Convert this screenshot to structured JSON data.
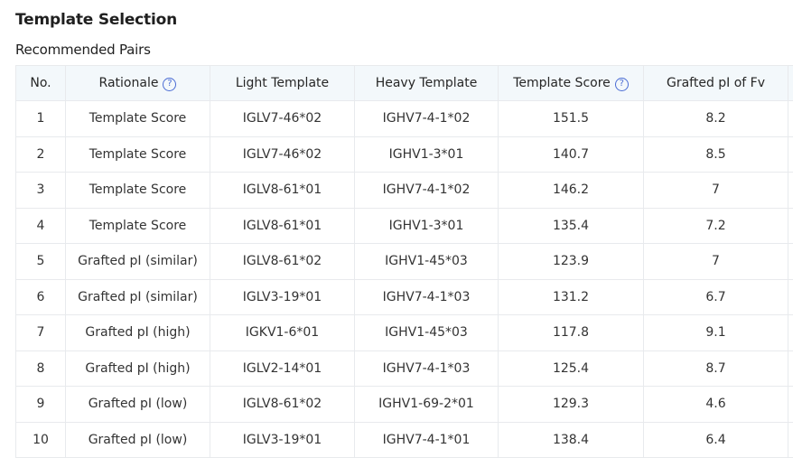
{
  "page": {
    "title": "Template Selection",
    "section_title": "Recommended Pairs"
  },
  "table": {
    "headers": {
      "no": "No.",
      "rationale": "Rationale",
      "light": "Light Template",
      "heavy": "Heavy Template",
      "score": "Template Score",
      "pi": "Grafted pI of Fv"
    },
    "rows": [
      {
        "no": "1",
        "rationale": "Template Score",
        "light": "IGLV7-46*02",
        "heavy": "IGHV7-4-1*02",
        "score": "151.5",
        "pi": "8.2"
      },
      {
        "no": "2",
        "rationale": "Template Score",
        "light": "IGLV7-46*02",
        "heavy": "IGHV1-3*01",
        "score": "140.7",
        "pi": "8.5"
      },
      {
        "no": "3",
        "rationale": "Template Score",
        "light": "IGLV8-61*01",
        "heavy": "IGHV7-4-1*02",
        "score": "146.2",
        "pi": "7"
      },
      {
        "no": "4",
        "rationale": "Template Score",
        "light": "IGLV8-61*01",
        "heavy": "IGHV1-3*01",
        "score": "135.4",
        "pi": "7.2"
      },
      {
        "no": "5",
        "rationale": "Grafted pI (similar)",
        "light": "IGLV8-61*02",
        "heavy": "IGHV1-45*03",
        "score": "123.9",
        "pi": "7"
      },
      {
        "no": "6",
        "rationale": "Grafted pI (similar)",
        "light": "IGLV3-19*01",
        "heavy": "IGHV7-4-1*03",
        "score": "131.2",
        "pi": "6.7"
      },
      {
        "no": "7",
        "rationale": "Grafted pI (high)",
        "light": "IGKV1-6*01",
        "heavy": "IGHV1-45*03",
        "score": "117.8",
        "pi": "9.1"
      },
      {
        "no": "8",
        "rationale": "Grafted pI (high)",
        "light": "IGLV2-14*01",
        "heavy": "IGHV7-4-1*03",
        "score": "125.4",
        "pi": "8.7"
      },
      {
        "no": "9",
        "rationale": "Grafted pI (low)",
        "light": "IGLV8-61*02",
        "heavy": "IGHV1-69-2*01",
        "score": "129.3",
        "pi": "4.6"
      },
      {
        "no": "10",
        "rationale": "Grafted pI (low)",
        "light": "IGLV3-19*01",
        "heavy": "IGHV7-4-1*01",
        "score": "138.4",
        "pi": "6.4"
      }
    ]
  },
  "icons": {
    "help": "question-circle-icon"
  },
  "colors": {
    "header_bg": "#f3f8fb",
    "accent": "#4a6cd4",
    "border": "#e8eaed"
  }
}
